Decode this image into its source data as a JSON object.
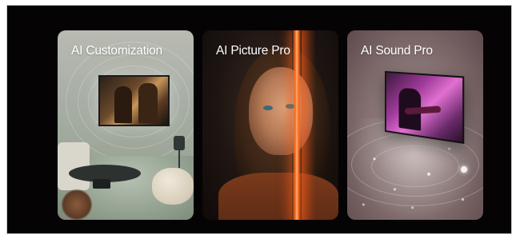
{
  "cards": [
    {
      "title": "AI Customization",
      "image": "living-room-tv"
    },
    {
      "title": "AI Picture Pro",
      "image": "portrait-light-beam"
    },
    {
      "title": "AI Sound Pro",
      "image": "floating-tv-guitarist"
    }
  ]
}
